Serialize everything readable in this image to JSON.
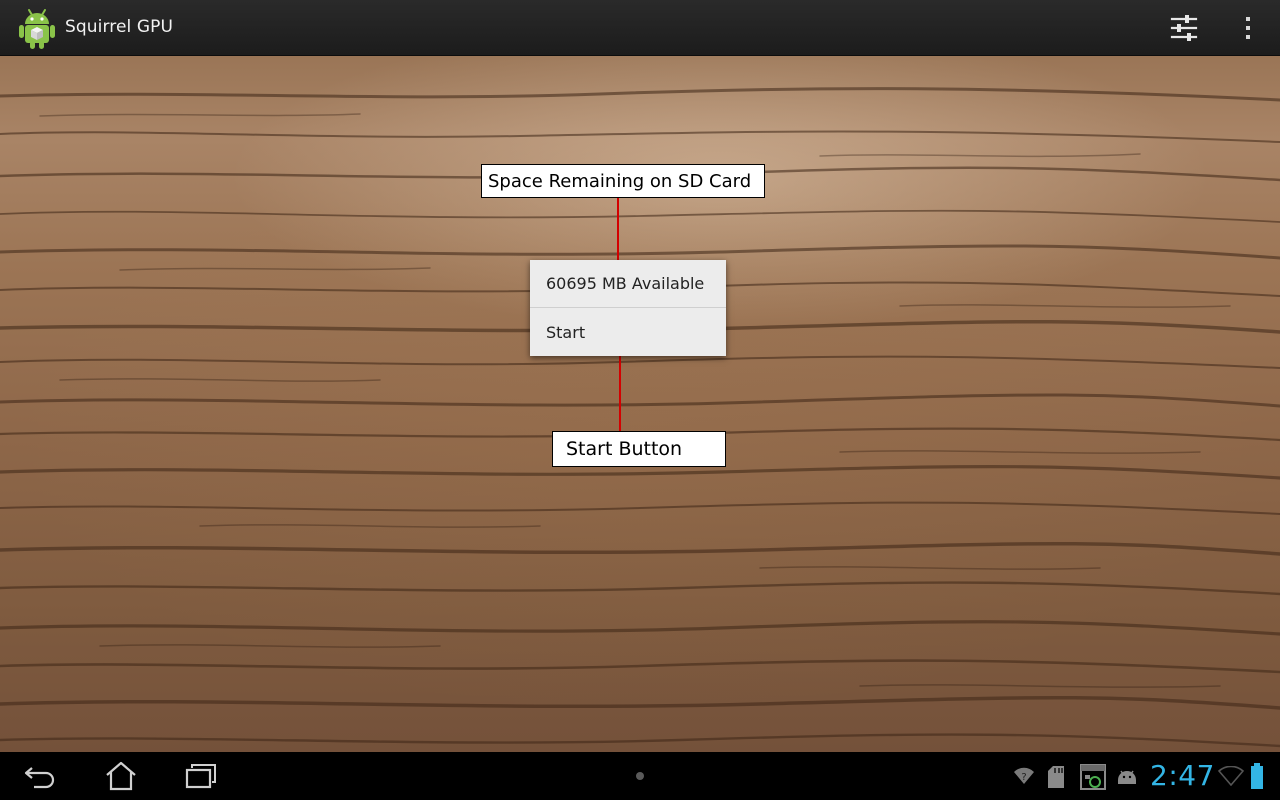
{
  "action_bar": {
    "title": "Squirrel GPU",
    "app_icon": "android-robot-icon",
    "settings_icon": "sliders-icon",
    "overflow_icon": "overflow-menu-icon"
  },
  "annotations": {
    "sd_card_label": "Space Remaining on SD Card",
    "start_button_label": "Start Button",
    "line_color": "#d40000"
  },
  "dialog": {
    "available_text": "60695 MB Available",
    "start_label": "Start"
  },
  "system_bar": {
    "nav_icons": [
      "back-icon",
      "home-icon",
      "recent-apps-icon"
    ],
    "status_icons": [
      "wifi-question-icon",
      "sd-card-icon",
      "screenshot-icon",
      "android-debug-icon",
      "wifi-icon",
      "battery-icon"
    ],
    "clock": "2:47",
    "clock_color": "#33b5e5"
  }
}
